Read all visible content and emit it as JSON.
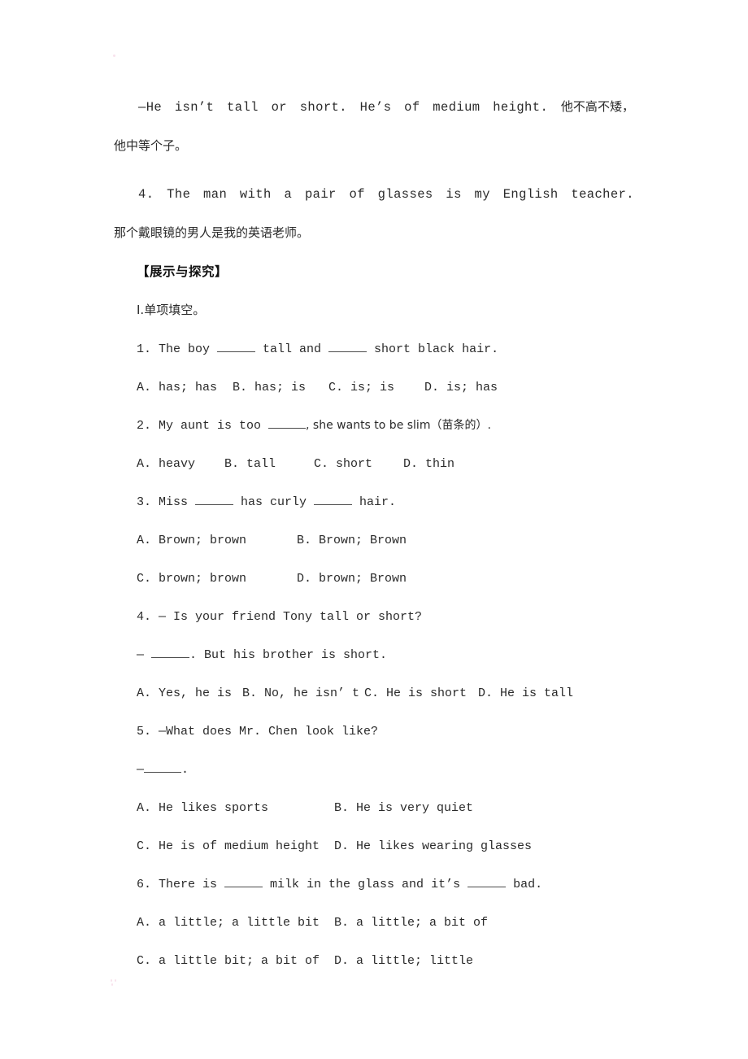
{
  "document": {
    "body_blocks": [
      {
        "type": "paragraph",
        "id": "answer-medium-height",
        "english": "—He  isn’t  tall  or  short.  He’s  of  medium  height. ",
        "chinese": "他不高不矮，他中等个子。"
      },
      {
        "type": "paragraph",
        "id": "sentence-4-glasses",
        "english": "4.  The  man  with  a  pair  of  glasses  is  my  English  teacher. ",
        "chinese": "那个戴眼镜的男人是我的英语老师。"
      }
    ],
    "section": {
      "heading": "【展示与探究】",
      "subheading": "Ⅰ.单项填空。"
    },
    "questions": [
      {
        "number": "1.",
        "stem_parts": [
          "1. The boy ",
          " tall and ",
          " short black hair."
        ],
        "stem_text": "1. The boy ______ tall and ______ short black hair.",
        "option_rows": [
          [
            {
              "key": "A.",
              "text": "A. has; has"
            },
            {
              "key": "B.",
              "text": "B. has; is"
            },
            {
              "key": "C.",
              "text": "C. is; is"
            },
            {
              "key": "D.",
              "text": "D. is; has"
            }
          ]
        ]
      },
      {
        "number": "2.",
        "stem_parts": [
          "2. My aunt is too ",
          ", she wants to be slim（苗条的）."
        ],
        "stem_text": "2. My aunt is too ______, she wants to be slim（苗条的）.",
        "option_rows": [
          [
            {
              "key": "A.",
              "text": "A. heavy"
            },
            {
              "key": "B.",
              "text": "B. tall"
            },
            {
              "key": "C.",
              "text": "C. short"
            },
            {
              "key": "D.",
              "text": "D. thin"
            }
          ]
        ]
      },
      {
        "number": "3.",
        "stem_parts": [
          "3. Miss ",
          " has curly ",
          " hair."
        ],
        "stem_text": "3. Miss ______ has curly ______ hair.",
        "option_rows": [
          [
            {
              "key": "A.",
              "text": "A. Brown; brown"
            },
            {
              "key": "B.",
              "text": "B. Brown; Brown"
            }
          ],
          [
            {
              "key": "C.",
              "text": "C. brown; brown"
            },
            {
              "key": "D.",
              "text": "D. brown; Brown"
            }
          ]
        ]
      },
      {
        "number": "4.",
        "stem_text": "4. — Is your friend Tony tall or short?",
        "reply_parts": [
          "— ",
          ". But his brother is short."
        ],
        "reply_text": "— ______. But his brother is short.",
        "option_rows": [
          [
            {
              "key": "A.",
              "text": "A. Yes, he is"
            },
            {
              "key": "B.",
              "text": "B. No, he isn’ t"
            },
            {
              "key": "C.",
              "text": "C. He is short"
            },
            {
              "key": "D.",
              "text": "D. He is tall"
            }
          ]
        ]
      },
      {
        "number": "5.",
        "stem_text": "5. —What does Mr. Chen look like?",
        "reply_parts": [
          "—",
          "."
        ],
        "reply_text": "—______.",
        "option_rows": [
          [
            {
              "key": "A.",
              "text": "A. He likes sports"
            },
            {
              "key": "B.",
              "text": "B. He is very quiet"
            }
          ],
          [
            {
              "key": "C.",
              "text": "C. He is of medium height"
            },
            {
              "key": "D.",
              "text": "D. He likes wearing glasses"
            }
          ]
        ]
      },
      {
        "number": "6.",
        "stem_parts": [
          "6. There is ",
          " milk in the glass and it’s ",
          " bad."
        ],
        "stem_text": "6. There is ______ milk in the glass and it’s ______ bad.",
        "option_rows": [
          [
            {
              "key": "A.",
              "text": "A. a little; a little bit"
            },
            {
              "key": "B.",
              "text": "B. a little; a bit of"
            }
          ],
          [
            {
              "key": "C.",
              "text": "C. a little bit; a bit of"
            },
            {
              "key": "D.",
              "text": "D. a little; little"
            }
          ]
        ]
      }
    ]
  },
  "colors": {
    "page_background": "#ffffff",
    "text": "#2a2a2a",
    "heading": "#111111",
    "rule": "#4a4a4a",
    "speck": "#f6d8e6"
  }
}
